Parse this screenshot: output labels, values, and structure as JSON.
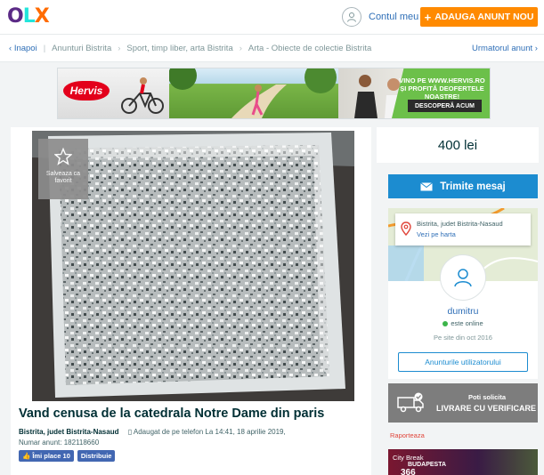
{
  "header": {
    "logo": {
      "o": "O",
      "l": "L",
      "x": "X"
    },
    "account_label": "Contul meu",
    "add_button_label": "ADAUGA ANUNT NOU",
    "add_button_plus": "+"
  },
  "breadcrumb": {
    "back_label": "Inapoi",
    "items": [
      "Anunturi Bistrita",
      "Sport, timp liber, arta Bistrita",
      "Arta - Obiecte de colectie Bistrita"
    ],
    "next_label": "Urmatorul anunt"
  },
  "banner": {
    "brand": "Hervis",
    "headline": "VINO PE WWW.HERVIS.RO ȘI PROFITĂ DEOFERTELE NOASTRE!",
    "cta": "DESCOPERĂ ACUM"
  },
  "listing": {
    "favorite_label": "Salveaza ca favorit",
    "title": "Vand cenusa de la catedrala Notre Dame din paris",
    "location": "Bistrita, judet Bistrita-Nasaud",
    "added_via": "Adaugat de pe telefon",
    "added_at": "La 14:41, 18 aprilie 2019,",
    "ad_number": "Numar anunt: 182118660",
    "like_label": "Îmi place 10",
    "share_label": "Distribuie"
  },
  "sidebar": {
    "price": "400 lei",
    "message_button": "Trimite mesaj",
    "seller": {
      "location": "Bistrita, judet Bistrita-Nasaud",
      "map_link": "Vezi pe harta",
      "name": "dumitru",
      "status": "este online",
      "member_since": "Pe site din oct 2016",
      "user_ads_button": "Anunturile utilizatorului"
    },
    "verify": {
      "line1": "Poti solicita",
      "line2": "LIVRARE CU VERIFICARE"
    },
    "report_link": "Raporteaza",
    "side_ad": {
      "line1": "City Break",
      "line2": "BUDAPESTA",
      "line3": "366"
    }
  },
  "colors": {
    "accent_orange": "#ff8a00",
    "link_blue": "#2f6fb7",
    "button_blue": "#1c8cd0",
    "online_green": "#3cb54a",
    "text_dark": "#002f34"
  }
}
